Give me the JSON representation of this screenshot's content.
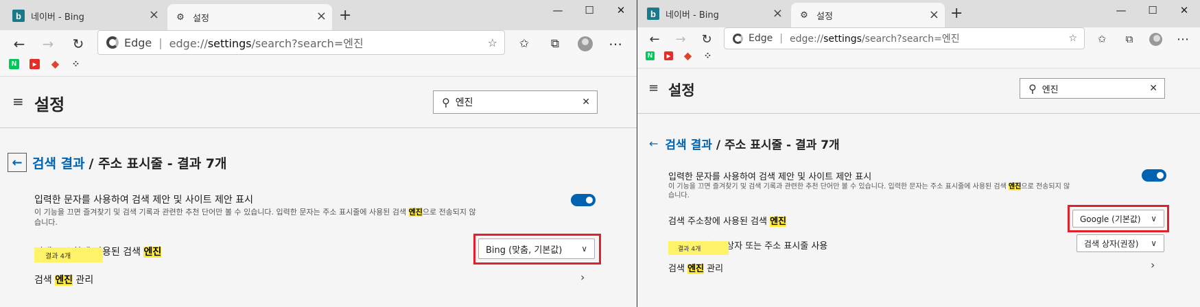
{
  "left": {
    "tabs": [
      {
        "label": "네이버 - Bing",
        "icon": "bing-icon"
      },
      {
        "label": "설정",
        "icon": "gear-icon"
      }
    ],
    "address": {
      "brand": "Edge",
      "url_scheme": "edge://",
      "url_path": "settings",
      "url_query": "/search?search=엔진"
    },
    "header_title": "설정",
    "search_value": "엔진",
    "breadcrumb": {
      "link": "검색 결과",
      "rest": "/ 주소 표시줄 - 결과 7개"
    },
    "suggest": {
      "title": "입력한 문자를 사용하여 검색 제안 및 사이트 제안 표시",
      "desc_before": "이 기능을 끄면 즐겨찾기 및 검색 기록과 관련한 추천 단어만 볼 수 있습니다. 입력한 문자는 주소 표시줄에 사용된 검색 ",
      "desc_hl": "엔진",
      "desc_after": "으로 전송되지 않",
      "desc_line2": "습니다.",
      "toggle_on": true
    },
    "engine_row": {
      "title_prefix": "검색 주소창에 사용된 검색 ",
      "title_hl": "엔진",
      "dropdown": "Bing (맞춤, 기본값)"
    },
    "tooltip": "결과 4개",
    "manage_row": {
      "prefix": "검색 ",
      "hl": "엔진",
      "suffix": " 관리"
    }
  },
  "right": {
    "tabs": [
      {
        "label": "네이버 - Bing",
        "icon": "bing-icon"
      },
      {
        "label": "설정",
        "icon": "gear-icon"
      }
    ],
    "address": {
      "brand": "Edge",
      "url_scheme": "edge://",
      "url_path": "settings",
      "url_query": "/search?search=엔진"
    },
    "header_title": "설정",
    "search_value": "엔진",
    "breadcrumb": {
      "link": "검색 결과",
      "rest": "/ 주소 표시줄 - 결과 7개"
    },
    "suggest": {
      "title": "입력한 문자를 사용하여 검색 제안 및 사이트 제안 표시",
      "desc_before": "이 기능을 끄면 즐겨찾기 및 검색 기록과 관련한 추천 단어만 볼 수 있습니다. 입력한 문자는 주소 표시줄에 사용된 검색 ",
      "desc_hl": "엔진",
      "desc_after": "으로 전송되지 않",
      "desc_line2": "습니다.",
      "toggle_on": true
    },
    "engine_row": {
      "title_prefix": "검색 주소창에 사용된 검색 ",
      "title_hl": "엔진",
      "dropdown": "Google (기본값)"
    },
    "newtab_row": {
      "title": "새 탭에서 검색 상자 또는 주소 표시줄 사용",
      "dropdown": "검색 상자(권장)"
    },
    "tooltip": "결과 4개",
    "manage_row": {
      "prefix": "검색 ",
      "hl": "엔진",
      "suffix": " 관리"
    }
  },
  "colors": {
    "accent": "#0063b1",
    "highlight": "#ffeb3b",
    "redbox": "#e0202a",
    "tooltip": "#fff36a"
  }
}
